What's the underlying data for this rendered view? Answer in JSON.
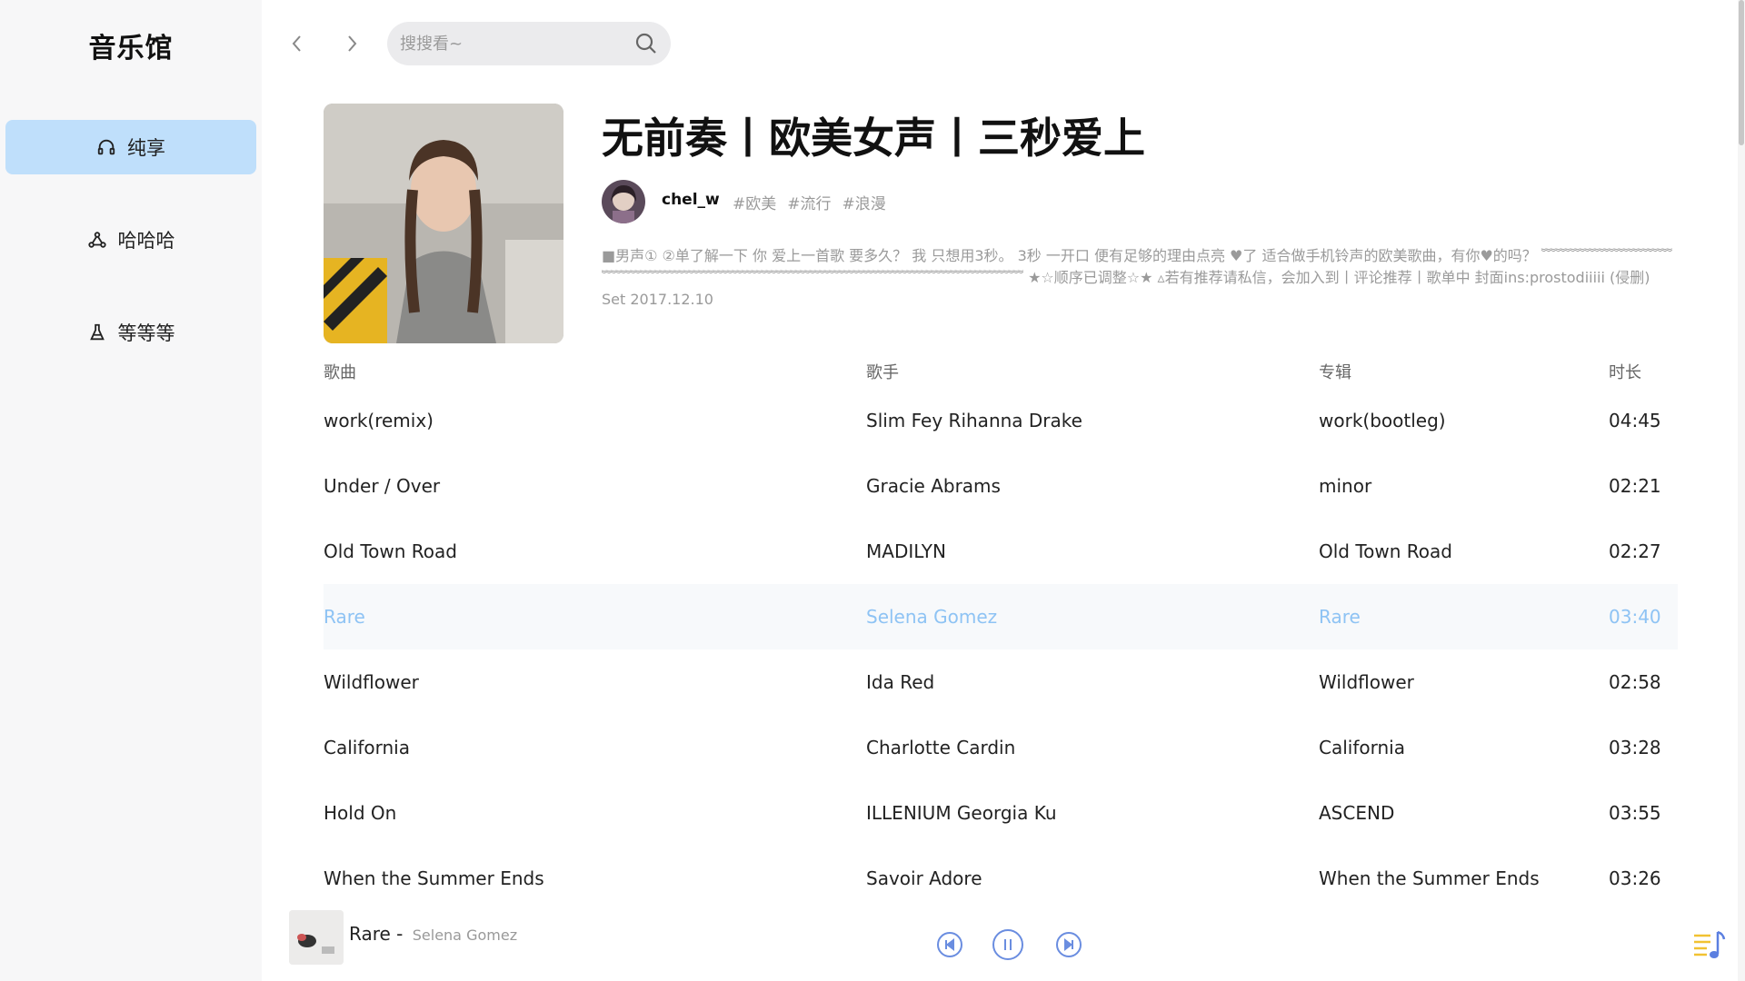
{
  "app": {
    "title": "音乐馆"
  },
  "sidebar": {
    "items": [
      {
        "label": "纯享",
        "icon": "headphones-icon",
        "active": true
      },
      {
        "label": "哈哈哈",
        "icon": "share-nodes-icon",
        "active": false
      },
      {
        "label": "等等等",
        "icon": "flask-icon",
        "active": false
      }
    ]
  },
  "search": {
    "placeholder": "搜搜看~"
  },
  "playlist": {
    "title": "无前奏丨欧美女声丨三秒爱上",
    "creator": "chel_w",
    "tags": [
      "#欧美",
      "#流行",
      "#浪漫"
    ],
    "description": "■男声① ②单了解一下 你 爱上一首歌 要多久？ 我 只想用3秒。 3秒 一开口 便有足够的理由点亮 ♥了 适合做手机铃声的欧美歌曲，有你♥的吗？ ﹌﹌﹌﹌﹌﹌﹌﹌﹌﹌﹌﹌﹌﹌﹌﹌﹌﹌﹌﹌﹌﹌﹌﹌﹌﹌﹌﹌﹌﹌﹌﹌﹌﹌﹌﹌﹌﹌ ★☆顺序已调整☆★ ▵若有推荐请私信，会加入到丨评论推荐丨歌单中 封面ins:prostodiiiii (侵删) Set 2017.12.10"
  },
  "table": {
    "headers": {
      "song": "歌曲",
      "artist": "歌手",
      "album": "专辑",
      "duration": "时长"
    },
    "rows": [
      {
        "song": "work(remix)",
        "artist": "Slim Fey  Rihanna  Drake",
        "album": "work(bootleg)",
        "duration": "04:45",
        "active": false
      },
      {
        "song": "Under / Over",
        "artist": "Gracie Abrams",
        "album": "minor",
        "duration": "02:21",
        "active": false
      },
      {
        "song": "Old Town Road",
        "artist": "MADILYN",
        "album": "Old Town Road",
        "duration": "02:27",
        "active": false
      },
      {
        "song": "Rare",
        "artist": "Selena Gomez",
        "album": "Rare",
        "duration": "03:40",
        "active": true
      },
      {
        "song": "Wildflower",
        "artist": "Ida Red",
        "album": "Wildflower",
        "duration": "02:58",
        "active": false
      },
      {
        "song": "California",
        "artist": "Charlotte Cardin",
        "album": "California",
        "duration": "03:28",
        "active": false
      },
      {
        "song": "Hold On",
        "artist": "ILLENIUM  Georgia Ku",
        "album": "ASCEND",
        "duration": "03:55",
        "active": false
      },
      {
        "song": "When the Summer Ends",
        "artist": "Savoir Adore",
        "album": "When the Summer Ends",
        "duration": "03:26",
        "active": false
      }
    ]
  },
  "player": {
    "title": "Rare",
    "separator": " - ",
    "artist": "Selena Gomez",
    "controls": [
      "previous-icon",
      "pause-icon",
      "next-icon"
    ],
    "queue_icon": "playlist-music-icon"
  },
  "colors": {
    "accent": "#bfdffb",
    "active_text": "#8ec3f4",
    "controls": "#6a8de0",
    "queue_icon": "#f1c232"
  }
}
